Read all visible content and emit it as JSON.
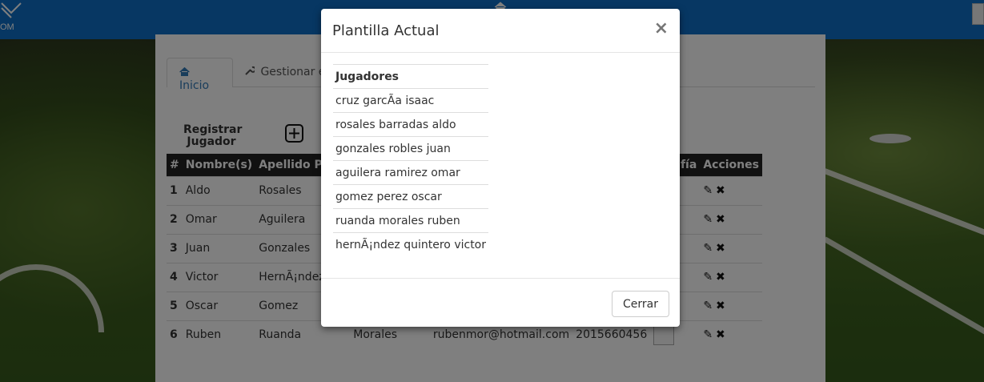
{
  "header": {
    "logo_text": "OM"
  },
  "tabs": [
    {
      "label": "Inicio",
      "icon": "home-icon"
    },
    {
      "label": "Gestionar eq",
      "icon": "wrench-icon"
    }
  ],
  "register": {
    "label_line1": "Registrar",
    "label_line2": "Jugador"
  },
  "table": {
    "headers": [
      "#",
      "Nombre(s)",
      "Apellido Pate",
      "",
      "",
      "",
      "rafía",
      "Acciones"
    ],
    "rows": [
      {
        "num": "1",
        "nombre": "Aldo",
        "paterno": "Rosales",
        "materno": "",
        "email": "",
        "telefono": ""
      },
      {
        "num": "2",
        "nombre": "Omar",
        "paterno": "Aguilera",
        "materno": "",
        "email": "",
        "telefono": ""
      },
      {
        "num": "3",
        "nombre": "Juan",
        "paterno": "Gonzales",
        "materno": "",
        "email": "",
        "telefono": ""
      },
      {
        "num": "4",
        "nombre": "Victor",
        "paterno": "HernÃ¡ndez",
        "materno": "",
        "email": "",
        "telefono": ""
      },
      {
        "num": "5",
        "nombre": "Oscar",
        "paterno": "Gomez",
        "materno": "",
        "email": "",
        "telefono": ""
      },
      {
        "num": "6",
        "nombre": "Ruben",
        "paterno": "Ruanda",
        "materno": "Morales",
        "email": "rubenmor@hotmail.com",
        "telefono": "2015660456"
      }
    ]
  },
  "modal": {
    "title": "Plantilla Actual",
    "close_symbol": "×",
    "list_header": "Jugadores",
    "players": [
      "cruz garcÃa isaac",
      "rosales barradas aldo",
      "gonzales robles juan",
      "aguilera ramirez omar",
      "gomez perez oscar",
      "ruanda morales ruben",
      "hernÃ¡ndez quintero victor"
    ],
    "close_button": "Cerrar"
  },
  "colors": {
    "brand_blue": "#0e6ec6",
    "table_header_bg": "#222222",
    "link_blue": "#337ab7"
  }
}
